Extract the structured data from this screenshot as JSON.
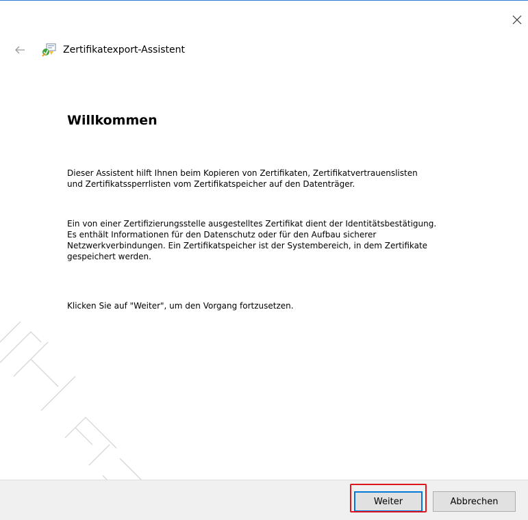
{
  "window": {
    "title": "Zertifikatexport-Assistent",
    "accent_color": "#2b7cd3"
  },
  "icons": {
    "close": "close-icon",
    "back": "back-arrow-icon",
    "app": "certificate-wizard-icon"
  },
  "content": {
    "heading": "Willkommen",
    "paragraph1_line1": "Dieser Assistent hilft Ihnen beim Kopieren von Zertifikaten, Zertifikatvertrauenslisten",
    "paragraph1_line2": "und Zertifikatssperrlisten vom Zertifikatspeicher auf den Datenträger.",
    "paragraph2_line1": "Ein von einer Zertifizierungsstelle ausgestelltes Zertifikat dient der Identitätsbestätigung.",
    "paragraph2_line2": "Es enthält Informationen für den Datenschutz oder für den Aufbau sicherer",
    "paragraph2_line3": "Netzwerkverbindungen. Ein Zertifikatspeicher ist der Systembereich, in dem Zertifikate",
    "paragraph2_line4": "gespeichert werden.",
    "paragraph3": "Klicken Sie auf \"Weiter\", um den Vorgang fortzusetzen."
  },
  "footer": {
    "next_label": "Weiter",
    "cancel_label": "Abbrechen",
    "highlight_color": "#e0161e"
  }
}
